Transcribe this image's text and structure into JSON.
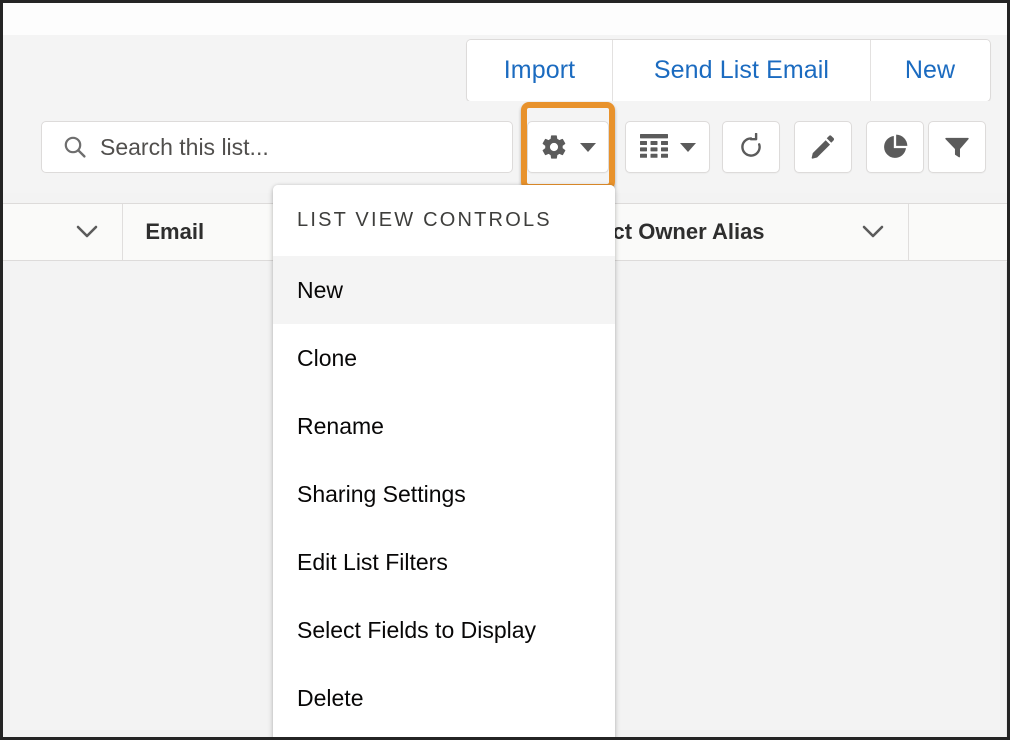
{
  "global_actions": {
    "buttons": [
      {
        "label": "Import",
        "name": "import-button"
      },
      {
        "label": "Send List Email",
        "name": "send-list-email-button"
      },
      {
        "label": "New",
        "name": "new-record-button"
      }
    ]
  },
  "search": {
    "placeholder": "Search this list...",
    "value": "",
    "icon": "search-icon"
  },
  "toolbar": {
    "items": [
      {
        "name": "list-view-controls-button",
        "icon": "gear-icon",
        "has_caret": true,
        "highlighted": true
      },
      {
        "name": "display-as-button",
        "icon": "table-icon",
        "has_caret": true,
        "highlighted": false
      },
      {
        "name": "refresh-button",
        "icon": "refresh-icon",
        "has_caret": false,
        "highlighted": false
      },
      {
        "name": "edit-button",
        "icon": "pencil-icon",
        "has_caret": false,
        "highlighted": false
      },
      {
        "name": "charts-button",
        "icon": "pie-chart-icon",
        "has_caret": false,
        "highlighted": false
      },
      {
        "name": "filter-button",
        "icon": "funnel-icon",
        "has_caret": false,
        "highlighted": false
      }
    ],
    "highlight_color": "#e8922c"
  },
  "table": {
    "columns": [
      {
        "label": "",
        "name": "column-header-first",
        "has_chevron": true
      },
      {
        "label": "Email",
        "name": "column-header-email",
        "has_chevron": false
      },
      {
        "label": "ct Owner Alias",
        "name": "column-header-account-owner-alias",
        "has_chevron": true
      },
      {
        "label": "",
        "name": "column-header-last",
        "has_chevron": false
      }
    ],
    "rows": []
  },
  "dropdown": {
    "title": "LIST VIEW CONTROLS",
    "items": [
      {
        "label": "New",
        "name": "menu-item-new",
        "active": true
      },
      {
        "label": "Clone",
        "name": "menu-item-clone",
        "active": false
      },
      {
        "label": "Rename",
        "name": "menu-item-rename",
        "active": false
      },
      {
        "label": "Sharing Settings",
        "name": "menu-item-sharing-settings",
        "active": false
      },
      {
        "label": "Edit List Filters",
        "name": "menu-item-edit-list-filters",
        "active": false
      },
      {
        "label": "Select Fields to Display",
        "name": "menu-item-select-fields-to-display",
        "active": false
      },
      {
        "label": "Delete",
        "name": "menu-item-delete",
        "active": false
      }
    ]
  },
  "colors": {
    "link_blue": "#1b6bc0",
    "highlight_orange": "#e8922c",
    "page_background": "#f4f4f4",
    "header_background": "#fafaf9"
  }
}
